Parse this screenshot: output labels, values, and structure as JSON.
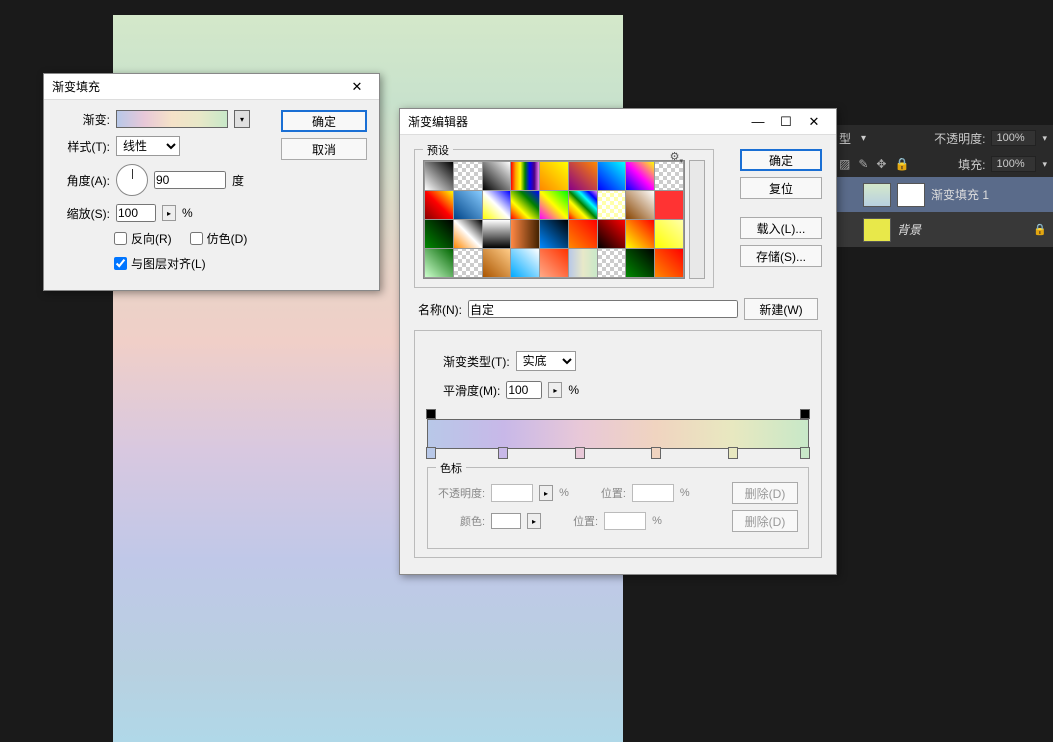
{
  "gradient_fill": {
    "title": "渐变填充",
    "gradient_label": "渐变:",
    "style_label": "样式(T):",
    "style_value": "线性",
    "angle_label": "角度(A):",
    "angle_value": "90",
    "angle_unit": "度",
    "scale_label": "缩放(S):",
    "scale_value": "100",
    "scale_unit": "%",
    "reverse_label": "反向(R)",
    "dither_label": "仿色(D)",
    "align_label": "与图层对齐(L)",
    "ok": "确定",
    "cancel": "取消"
  },
  "gradient_editor": {
    "title": "渐变编辑器",
    "presets_label": "预设",
    "ok": "确定",
    "reset": "复位",
    "load": "载入(L)...",
    "save": "存储(S)...",
    "name_label": "名称(N):",
    "name_value": "自定",
    "new_btn": "新建(W)",
    "type_label": "渐变类型(T):",
    "type_value": "实底",
    "smooth_label": "平滑度(M):",
    "smooth_value": "100",
    "smooth_unit": "%",
    "colorstops_label": "色标",
    "opacity_label": "不透明度:",
    "opacity_unit": "%",
    "position_label": "位置:",
    "position_unit": "%",
    "delete_d": "删除(D)",
    "color_label": "颜色:"
  },
  "right_panel": {
    "opacity_label": "不透明度:",
    "opacity_value": "100%",
    "fill_label": "填充:",
    "fill_value": "100%",
    "layer1": "渐变填充 1",
    "layer_bg": "背景",
    "blend_suffix": "型"
  }
}
